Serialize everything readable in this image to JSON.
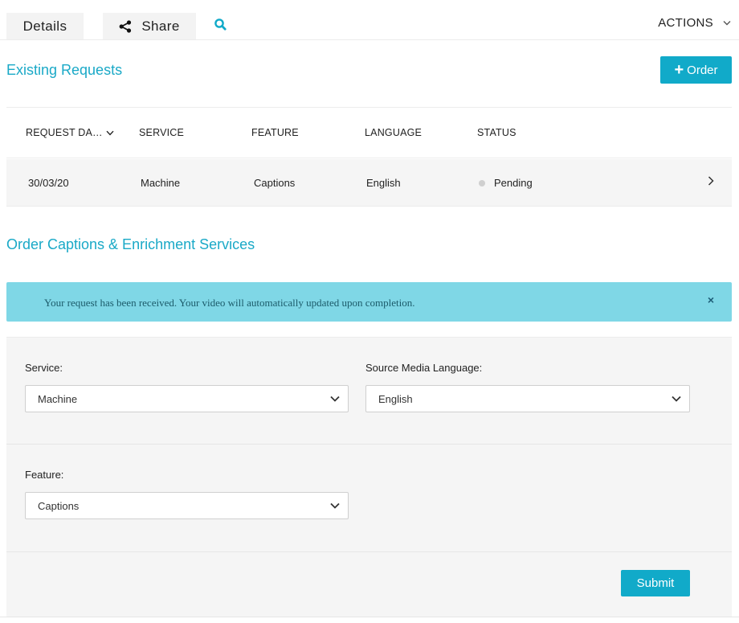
{
  "tabs": {
    "details_label": "Details",
    "share_label": "Share",
    "actions_label": "ACTIONS"
  },
  "icons": {
    "share": "share-icon",
    "search": "search-icon",
    "actions_chevron": "chevron-down-icon",
    "sort": "chevron-down-icon",
    "row": "chevron-right-icon",
    "close": "close-icon",
    "plus": "plus-icon"
  },
  "colors": {
    "accent": "#11aac9",
    "title": "#1aa9c7",
    "alert_bg": "#7fd7e6",
    "status_pending": "#cfcfcf"
  },
  "existing": {
    "title": "Existing Requests",
    "order_button": "Order",
    "order_plus": "+",
    "columns": [
      "REQUEST DA…",
      "SERVICE",
      "FEATURE",
      "LANGUAGE",
      "STATUS"
    ],
    "rows": [
      {
        "date": "30/03/20",
        "service": "Machine",
        "feature": "Captions",
        "language": "English",
        "status": "Pending"
      }
    ]
  },
  "order": {
    "title": "Order Captions & Enrichment Services",
    "alert_text": "Your request has been received. Your video will automatically updated upon completion.",
    "alert_close": "×",
    "service_label": "Service:",
    "service_value": "Machine",
    "language_label": "Source Media Language:",
    "language_value": "English",
    "feature_label": "Feature:",
    "feature_value": "Captions",
    "submit_label": "Submit"
  }
}
